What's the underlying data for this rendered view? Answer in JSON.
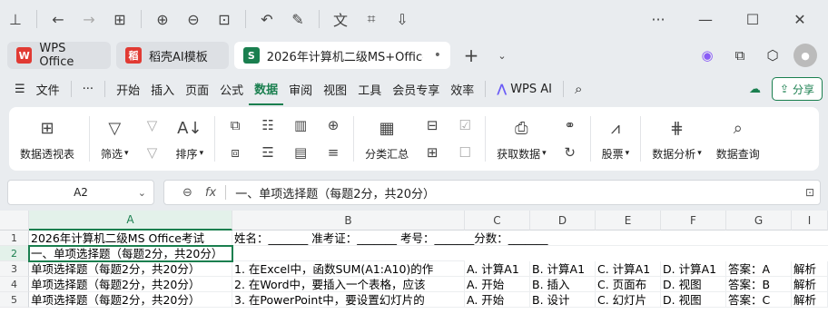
{
  "toolbar": {
    "icons": [
      "pin-icon",
      "back-icon",
      "forward-icon",
      "grid-icon",
      "zoom-in-icon",
      "zoom-out-icon",
      "fit-icon",
      "rotate-icon",
      "edit-icon",
      "translate-icon",
      "capture-icon",
      "download-icon",
      "more-icon",
      "minimize-icon",
      "maximize-icon",
      "close-icon"
    ]
  },
  "tabs": [
    {
      "label": "WPS Office",
      "logo": "W"
    },
    {
      "label": "稻壳AI模板",
      "logo": "稻"
    },
    {
      "label": "2026年计算机二级MS+Office考",
      "logo": "S"
    }
  ],
  "menu": {
    "file": "文件",
    "more": "···",
    "items": [
      "开始",
      "插入",
      "页面",
      "公式",
      "数据",
      "审阅",
      "视图",
      "工具",
      "会员专享",
      "效率"
    ],
    "active": "数据",
    "wps_ai": "WPS AI",
    "share": "分享"
  },
  "ribbon": {
    "pivot": "数据透视表",
    "filter": "筛选",
    "sort": "排序",
    "subtotal": "分类汇总",
    "get_data": "获取数据",
    "stocks": "股票",
    "analysis": "数据分析",
    "query": "数据查询"
  },
  "formula_bar": {
    "cell_ref": "A2",
    "fx": "fx",
    "content": "一、单项选择题（每题2分，共20分）"
  },
  "sheet": {
    "columns": [
      "A",
      "B",
      "C",
      "D",
      "E",
      "F",
      "G",
      "I"
    ],
    "selected_column": "A",
    "rows": [
      {
        "num": "1",
        "cells": [
          "2026年计算机二级MS Office考试",
          "姓名：_______ 准考证：_______  考号：_______分数：_______",
          "",
          "",
          "",
          "",
          "",
          ""
        ]
      },
      {
        "num": "2",
        "cells": [
          "一、单项选择题（每题2分，共20分）",
          "",
          "",
          "",
          "",
          "",
          "",
          ""
        ]
      },
      {
        "num": "3",
        "cells": [
          "单项选择题（每题2分，共20分）",
          "1. 在Excel中，函数SUM(A1:A10)的作",
          "A. 计算A1",
          "B. 计算A1",
          "C. 计算A1",
          "D. 计算A1",
          "答案：A",
          "解析"
        ]
      },
      {
        "num": "4",
        "cells": [
          "单项选择题（每题2分，共20分）",
          "2. 在Word中，要插入一个表格，应该",
          "A. 开始",
          "B. 插入",
          "C. 页面布",
          "D. 视图",
          "答案：B",
          "解析"
        ]
      },
      {
        "num": "5",
        "cells": [
          "单项选择题（每题2分，共20分）",
          "3. 在PowerPoint中，要设置幻灯片的",
          "A. 开始",
          "B. 设计",
          "C. 幻灯片",
          "D. 视图",
          "答案：C",
          "解析"
        ]
      }
    ],
    "selected_row": "2"
  },
  "colors": {
    "accent": "#1a7f4f",
    "wps_red": "#e13a33"
  }
}
